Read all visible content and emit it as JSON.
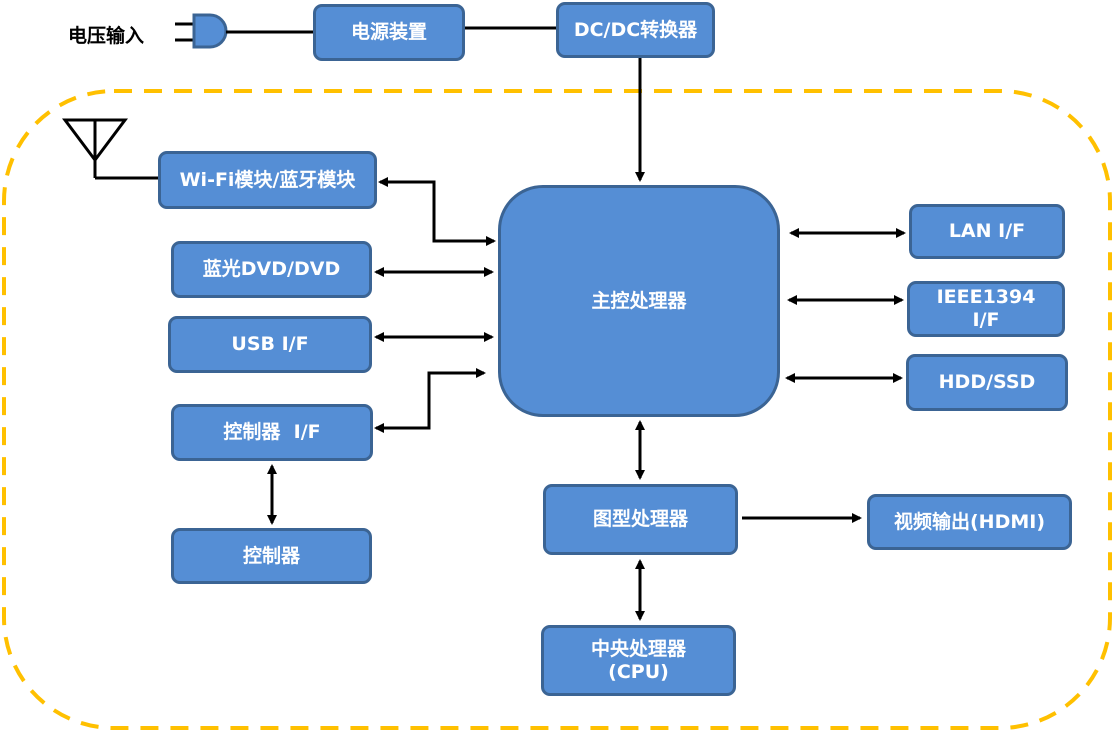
{
  "colors": {
    "box_fill": "#558ed5",
    "box_border": "#3b6494",
    "boundary": "#ffc000",
    "line": "#000000"
  },
  "input_label": "电压输入",
  "icons": {
    "plug": "power-plug-icon",
    "antenna": "antenna-icon"
  },
  "boxes": {
    "power": "电源装置",
    "dcdc": "DC/DC转换器",
    "wifi": "Wi-Fi模块/蓝牙模块",
    "dvd": "蓝光DVD/DVD",
    "usb": "USB I/F",
    "ctrl_if": "控制器  I/F",
    "ctrl": "控制器",
    "main": "主控处理器",
    "lan": "LAN I/F",
    "ieee": "IEEE1394 I/F",
    "hdd": "HDD/SSD",
    "gpu": "图型处理器",
    "hdmi": "视频输出(HDMI)",
    "cpu": "中央处理器 (CPU)"
  }
}
